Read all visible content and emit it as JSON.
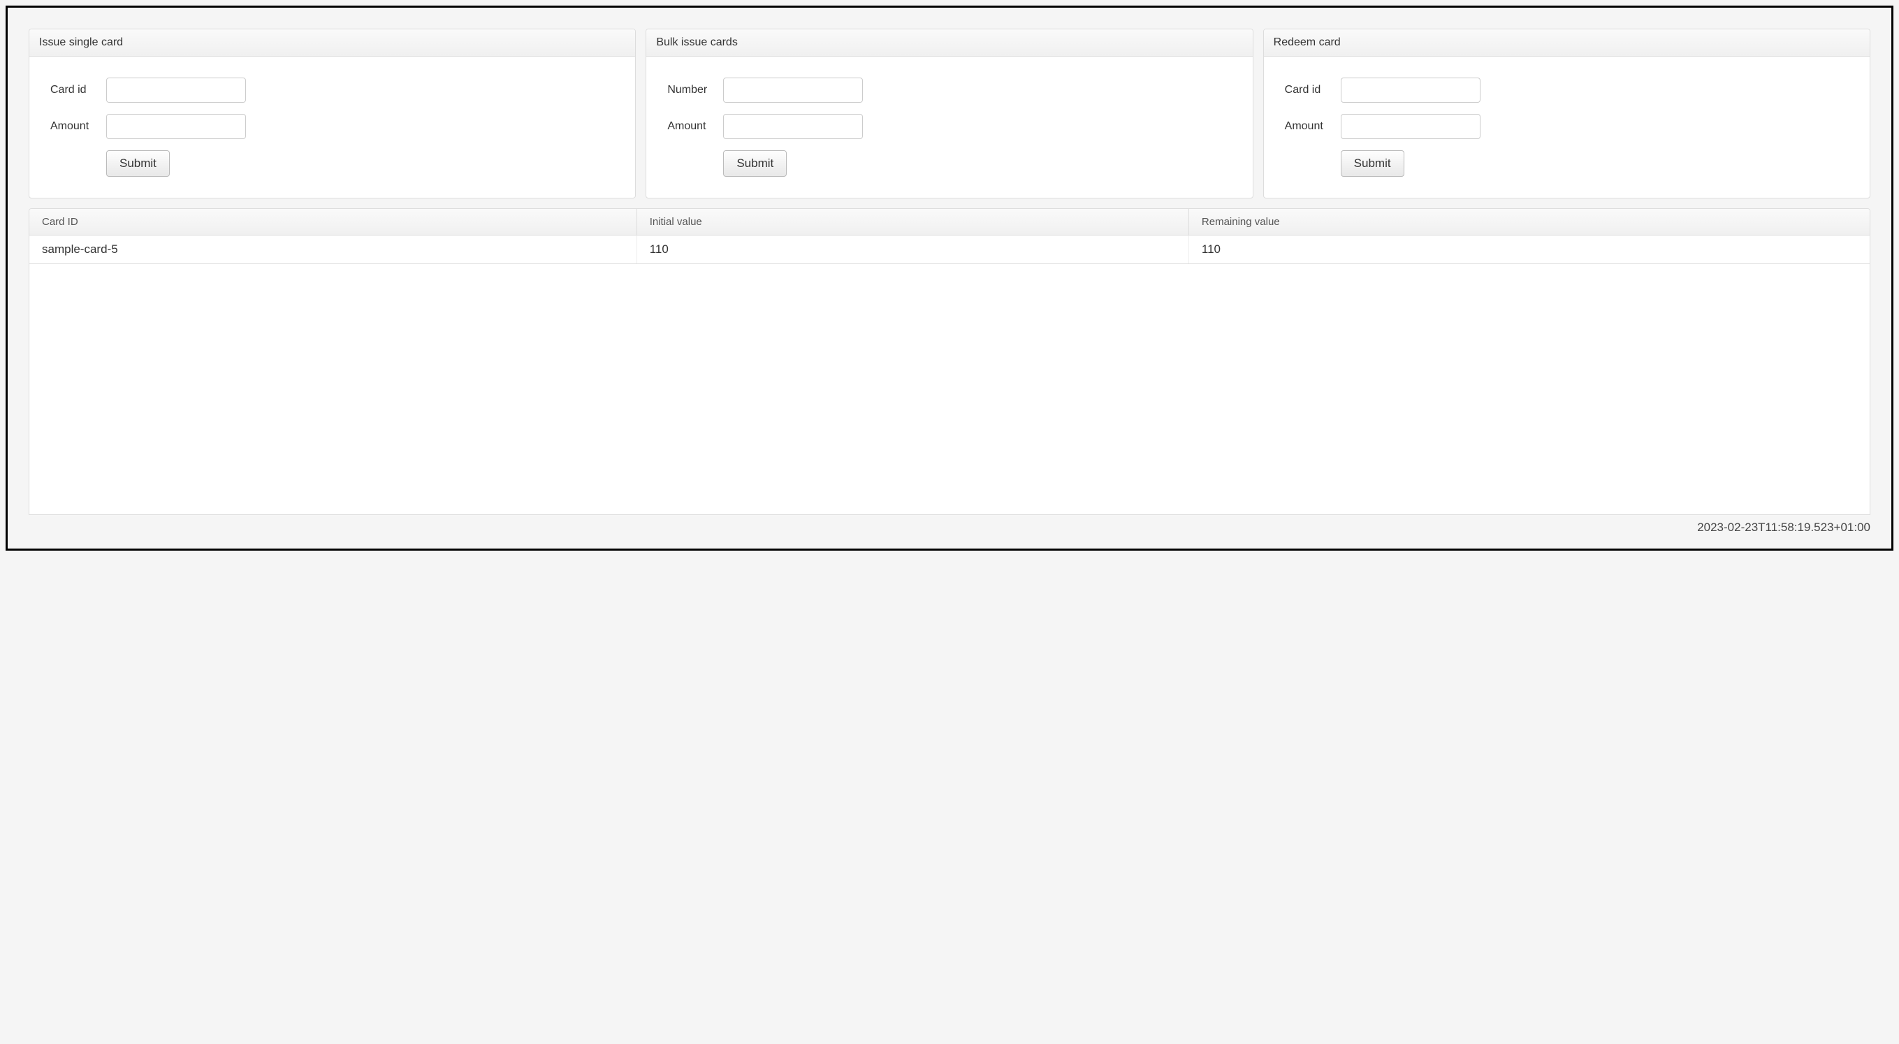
{
  "panels": {
    "issue_single": {
      "title": "Issue single card",
      "card_id_label": "Card id",
      "amount_label": "Amount",
      "submit_label": "Submit"
    },
    "bulk_issue": {
      "title": "Bulk issue cards",
      "number_label": "Number",
      "amount_label": "Amount",
      "submit_label": "Submit"
    },
    "redeem": {
      "title": "Redeem card",
      "card_id_label": "Card id",
      "amount_label": "Amount",
      "submit_label": "Submit"
    }
  },
  "table": {
    "headers": {
      "card_id": "Card ID",
      "initial_value": "Initial value",
      "remaining_value": "Remaining value"
    },
    "rows": [
      {
        "card_id": "sample-card-5",
        "initial_value": "110",
        "remaining_value": "110"
      }
    ]
  },
  "timestamp": "2023-02-23T11:58:19.523+01:00"
}
